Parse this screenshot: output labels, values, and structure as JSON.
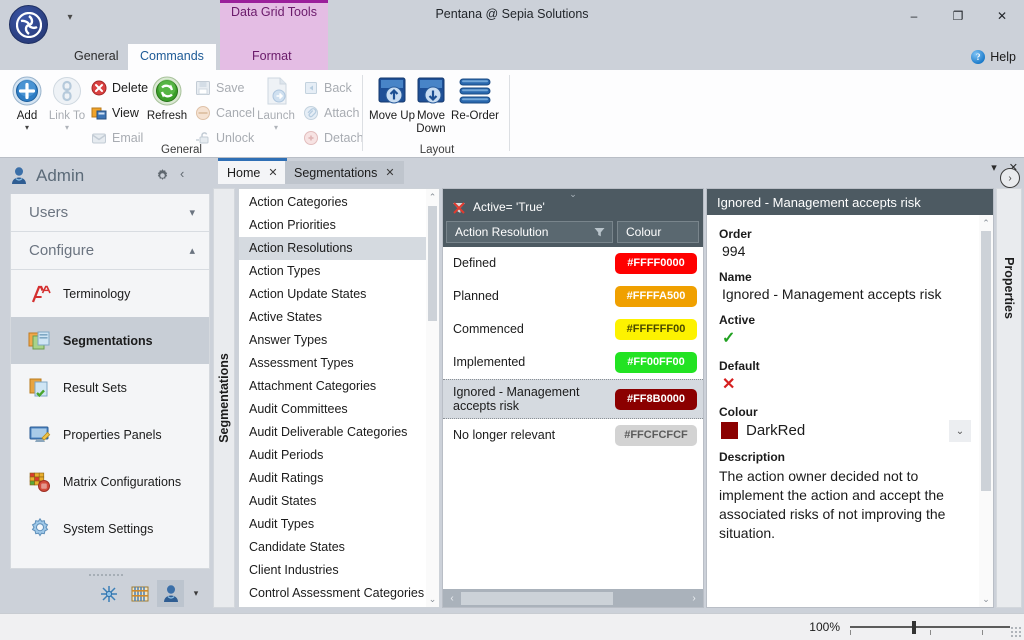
{
  "window": {
    "title": "Pentana @ Sepia Solutions",
    "minimize": "–",
    "maximize": "❐",
    "close": "✕",
    "qat_more": "▾"
  },
  "ribbon": {
    "tabs": [
      {
        "label": "General",
        "selected": false
      },
      {
        "label": "Commands",
        "selected": true
      }
    ],
    "contextual_group": {
      "title": "Data Grid Tools",
      "tab": "Format",
      "accent": "#9b1f9b",
      "background": "#e4bde4"
    },
    "help": {
      "label": "Help",
      "icon": "help-circle-icon",
      "glyph": "?"
    },
    "groups": [
      {
        "name": "General",
        "big_buttons": [
          {
            "label": "Add",
            "icon": "add-circle-icon",
            "has_caret": true,
            "disabled": false
          },
          {
            "label": "Link To",
            "icon": "link-icon",
            "has_caret": true,
            "disabled": true
          },
          {
            "label": "Refresh",
            "icon": "refresh-icon",
            "has_caret": false,
            "disabled": false
          },
          {
            "label": "Launch",
            "icon": "launch-document-icon",
            "has_caret": true,
            "disabled": true
          }
        ],
        "small_buttons": [
          {
            "label": "Delete",
            "icon": "delete-icon",
            "disabled": false
          },
          {
            "label": "View",
            "icon": "view-icon",
            "disabled": false
          },
          {
            "label": "Email",
            "icon": "email-icon",
            "disabled": true
          },
          {
            "label": "Save",
            "icon": "save-icon",
            "disabled": true
          },
          {
            "label": "Cancel",
            "icon": "cancel-icon",
            "disabled": true
          },
          {
            "label": "Unlock",
            "icon": "unlock-icon",
            "disabled": true
          },
          {
            "label": "Back",
            "icon": "back-icon",
            "disabled": true
          },
          {
            "label": "Attach",
            "icon": "attach-icon",
            "disabled": true
          },
          {
            "label": "Detach",
            "icon": "detach-icon",
            "disabled": true
          }
        ]
      },
      {
        "name": "Layout",
        "big_buttons": [
          {
            "label": "Move Up",
            "icon": "move-up-icon",
            "has_caret": false,
            "disabled": false
          },
          {
            "label": "Move Down",
            "icon": "move-down-icon",
            "has_caret": false,
            "disabled": false
          },
          {
            "label": "Re-Order",
            "icon": "re-order-icon",
            "has_caret": false,
            "disabled": false
          }
        ]
      }
    ]
  },
  "sidebar": {
    "title": "Admin",
    "gear_icon": "gear-icon",
    "collapse_icon": "chevron-left-icon",
    "sections": [
      {
        "label": "Users",
        "expanded": false,
        "chevron": "⌄"
      },
      {
        "label": "Configure",
        "expanded": true,
        "chevron": "⌃"
      }
    ],
    "items": [
      {
        "label": "Terminology",
        "icon": "terminology-icon",
        "selected": false
      },
      {
        "label": "Segmentations",
        "icon": "segmentations-icon",
        "selected": true
      },
      {
        "label": "Result Sets",
        "icon": "result-sets-icon",
        "selected": false
      },
      {
        "label": "Properties Panels",
        "icon": "properties-panels-icon",
        "selected": false
      },
      {
        "label": "Matrix Configurations",
        "icon": "matrix-configurations-icon",
        "selected": false
      },
      {
        "label": "System Settings",
        "icon": "system-settings-icon",
        "selected": false
      }
    ],
    "footer_icons": [
      {
        "name": "network-icon",
        "selected": false
      },
      {
        "name": "abacus-icon",
        "selected": false
      },
      {
        "name": "admin-user-icon",
        "selected": true
      },
      {
        "name": "overflow-caret-icon",
        "selected": false
      }
    ]
  },
  "doc_tabs": {
    "tabs": [
      {
        "label": "Home",
        "selected": true,
        "close": "✕"
      },
      {
        "label": "Segmentations",
        "selected": false,
        "close": "✕"
      }
    ],
    "menu_caret": "▾",
    "close": "✕"
  },
  "segmentations_strip": "Segmentations",
  "segmentation_list": {
    "items": [
      {
        "label": "Action Categories",
        "selected": false
      },
      {
        "label": "Action Priorities",
        "selected": false
      },
      {
        "label": "Action Resolutions",
        "selected": true
      },
      {
        "label": "Action Types",
        "selected": false
      },
      {
        "label": "Action Update States",
        "selected": false
      },
      {
        "label": "Active States",
        "selected": false
      },
      {
        "label": "Answer Types",
        "selected": false
      },
      {
        "label": "Assessment Types",
        "selected": false
      },
      {
        "label": "Attachment Categories",
        "selected": false
      },
      {
        "label": "Audit Committees",
        "selected": false
      },
      {
        "label": "Audit Deliverable Categories",
        "selected": false
      },
      {
        "label": "Audit Periods",
        "selected": false
      },
      {
        "label": "Audit Ratings",
        "selected": false
      },
      {
        "label": "Audit States",
        "selected": false
      },
      {
        "label": "Audit Types",
        "selected": false
      },
      {
        "label": "Candidate States",
        "selected": false
      },
      {
        "label": "Client Industries",
        "selected": false
      },
      {
        "label": "Control Assessment Categories",
        "selected": false
      }
    ],
    "scroll_up": "⌃",
    "scroll_down": "⌄"
  },
  "grid": {
    "filter_text": "Active= 'True'",
    "filter_icon": "filter-remove-icon",
    "drop_caret": "⌄",
    "columns": [
      {
        "label": "Action Resolution",
        "has_filter": true
      },
      {
        "label": "Colour",
        "has_filter": false
      }
    ],
    "rows": [
      {
        "name": "Defined",
        "colour_label": "#FFFF0000",
        "swatch": "#ff0000",
        "text_colour": "#ffffff",
        "selected": false
      },
      {
        "name": "Planned",
        "colour_label": "#FFFFA500",
        "swatch": "#f0a000",
        "text_colour": "#ffffff",
        "selected": false
      },
      {
        "name": "Commenced",
        "colour_label": "#FFFFFF00",
        "swatch": "#fdf200",
        "text_colour": "#4a4a00",
        "selected": false
      },
      {
        "name": "Implemented",
        "colour_label": "#FF00FF00",
        "swatch": "#22e322",
        "text_colour": "#ffffff",
        "selected": false
      },
      {
        "name": "Ignored - Management accepts risk",
        "colour_label": "#FF8B0000",
        "swatch": "#8b0000",
        "text_colour": "#ffffff",
        "selected": true
      },
      {
        "name": "No longer relevant",
        "colour_label": "#FFCFCFCF",
        "swatch": "#d3d3d3",
        "text_colour": "#5b5b5b",
        "selected": false
      }
    ],
    "hscroll_left": "‹",
    "hscroll_right": "›"
  },
  "properties": {
    "header": "Ignored - Management accepts risk",
    "strip_label": "Properties",
    "expand_icon": "chevron-right-circle-icon",
    "fields": [
      {
        "label": "Order",
        "type": "text",
        "value": "994"
      },
      {
        "label": "Name",
        "type": "text",
        "value": "Ignored - Management accepts risk"
      },
      {
        "label": "Active",
        "type": "check",
        "value": "✓"
      },
      {
        "label": "Default",
        "type": "cross",
        "value": "✕"
      },
      {
        "label": "Colour",
        "type": "colour",
        "value": "DarkRed",
        "swatch": "#8b0000",
        "caret": "⌄"
      },
      {
        "label": "Description",
        "type": "paragraph",
        "value": "The action owner decided not to implement the action and accept the associated risks of not improving the situation."
      }
    ],
    "scroll_up": "⌃",
    "scroll_down": "⌄"
  },
  "status_bar": {
    "zoom_level": "100%"
  }
}
